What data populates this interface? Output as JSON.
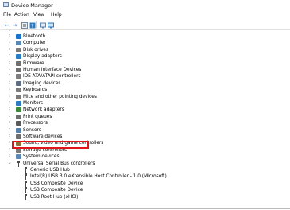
{
  "window": {
    "title": "Device Manager"
  },
  "menu": [
    "File",
    "Action",
    "View",
    "Help"
  ],
  "toolbar": {
    "buttons": [
      "back-arrow-icon",
      "forward-arrow-icon",
      "properties-icon",
      "help-icon",
      "scan-icon",
      "monitor-icon"
    ]
  },
  "tree": {
    "categories": [
      {
        "label": "Bluetooth",
        "icon_color": "#1a73c8"
      },
      {
        "label": "Computer",
        "icon_color": "#5b87b5"
      },
      {
        "label": "Disk drives",
        "icon_color": "#7a7a7a"
      },
      {
        "label": "Display adapters",
        "icon_color": "#2b7cc4"
      },
      {
        "label": "Firmware",
        "icon_color": "#6f6f6f"
      },
      {
        "label": "Human Interface Devices",
        "icon_color": "#6f6f6f"
      },
      {
        "label": "IDE ATA/ATAPI controllers",
        "icon_color": "#7d7d7d"
      },
      {
        "label": "Imaging devices",
        "icon_color": "#5e6e80"
      },
      {
        "label": "Keyboards",
        "icon_color": "#7a7a7a"
      },
      {
        "label": "Mice and other pointing devices",
        "icon_color": "#7a7a7a"
      },
      {
        "label": "Monitors",
        "icon_color": "#2b7cc4"
      },
      {
        "label": "Network adapters",
        "icon_color": "#3a8a3a"
      },
      {
        "label": "Print queues",
        "icon_color": "#6f6f6f"
      },
      {
        "label": "Processors",
        "icon_color": "#5a5a5a"
      },
      {
        "label": "Sensors",
        "icon_color": "#5a7fa8"
      },
      {
        "label": "Software devices",
        "icon_color": "#6f6f6f"
      },
      {
        "label": "Sound, video and game controllers",
        "icon_color": "#8a6f3a"
      },
      {
        "label": "Storage controllers",
        "icon_color": "#7a7a7a"
      },
      {
        "label": "System devices",
        "icon_color": "#5b87b5"
      }
    ],
    "expanded": {
      "label": "Universal Serial Bus controllers"
    },
    "children": [
      "Generic USB Hub",
      "Intel(R) USB 3.0 eXtensible Host Controller - 1.0 (Microsoft)",
      "USB Composite Device",
      "USB Composite Device",
      "USB Root Hub (xHCI)"
    ]
  },
  "colors": {
    "highlight": "#e0151a",
    "toolbar_icon": "#1b6ac0"
  }
}
